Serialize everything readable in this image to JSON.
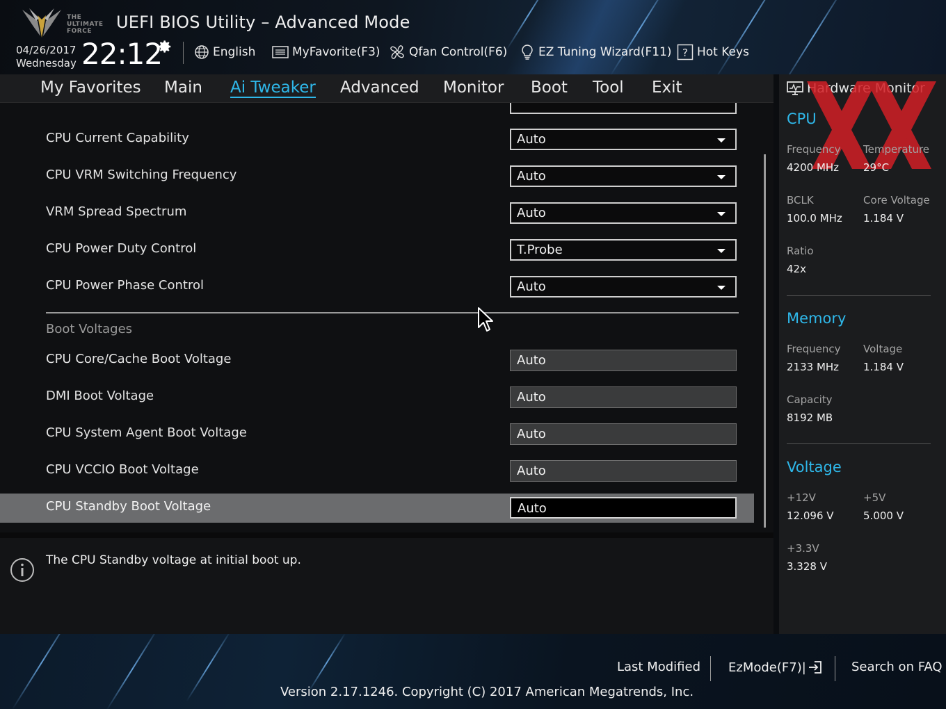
{
  "header": {
    "logo_text": "THE ULTIMATE FORCE",
    "title": "UEFI BIOS Utility – Advanced Mode",
    "date": "04/26/2017",
    "weekday": "Wednesday",
    "time": "22:12",
    "tools": {
      "language": "English",
      "favorite": "MyFavorite(F3)",
      "qfan": "Qfan Control(F6)",
      "ez_tuning": "EZ Tuning Wizard(F11)",
      "hot_keys": "Hot Keys"
    }
  },
  "nav": {
    "tabs": [
      "My Favorites",
      "Main",
      "Ai Tweaker",
      "Advanced",
      "Monitor",
      "Boot",
      "Tool",
      "Exit"
    ],
    "active": "Ai Tweaker"
  },
  "settings": [
    {
      "label": "CPU Current Capability",
      "value": "Auto",
      "type": "select"
    },
    {
      "label": "CPU VRM Switching Frequency",
      "value": "Auto",
      "type": "select"
    },
    {
      "label": "VRM Spread Spectrum",
      "value": "Auto",
      "type": "select"
    },
    {
      "label": "CPU Power Duty Control",
      "value": "T.Probe",
      "type": "select"
    },
    {
      "label": "CPU Power Phase Control",
      "value": "Auto",
      "type": "select"
    }
  ],
  "boot_voltages": {
    "title": "Boot Voltages",
    "items": [
      {
        "label": "CPU Core/Cache Boot Voltage",
        "value": "Auto"
      },
      {
        "label": "DMI Boot Voltage",
        "value": "Auto"
      },
      {
        "label": "CPU System Agent Boot Voltage",
        "value": "Auto"
      },
      {
        "label": "CPU VCCIO Boot Voltage",
        "value": "Auto"
      },
      {
        "label": "CPU Standby Boot Voltage",
        "value": "Auto"
      }
    ]
  },
  "help": {
    "text": "The CPU Standby voltage at initial boot up."
  },
  "hw_monitor": {
    "title": "Hardware Monitor",
    "cpu": {
      "title": "CPU",
      "frequency_label": "Frequency",
      "frequency": "4200 MHz",
      "temperature_label": "Temperature",
      "temperature": "29°C",
      "bclk_label": "BCLK",
      "bclk": "100.0 MHz",
      "core_voltage_label": "Core Voltage",
      "core_voltage": "1.184 V",
      "ratio_label": "Ratio",
      "ratio": "42x"
    },
    "memory": {
      "title": "Memory",
      "frequency_label": "Frequency",
      "frequency": "2133 MHz",
      "voltage_label": "Voltage",
      "voltage": "1.184 V",
      "capacity_label": "Capacity",
      "capacity": "8192 MB"
    },
    "voltage": {
      "title": "Voltage",
      "v12_label": "+12V",
      "v12": "12.096 V",
      "v5_label": "+5V",
      "v5": "5.000 V",
      "v33_label": "+3.3V",
      "v33": "3.328 V"
    }
  },
  "footer": {
    "last_modified": "Last Modified",
    "ezmode": "EzMode(F7)|",
    "search_faq": "Search on FAQ",
    "version": "Version 2.17.1246. Copyright (C) 2017 American Megatrends, Inc."
  },
  "colors": {
    "accent": "#2fb8ea",
    "watermark": "#d21f26"
  }
}
